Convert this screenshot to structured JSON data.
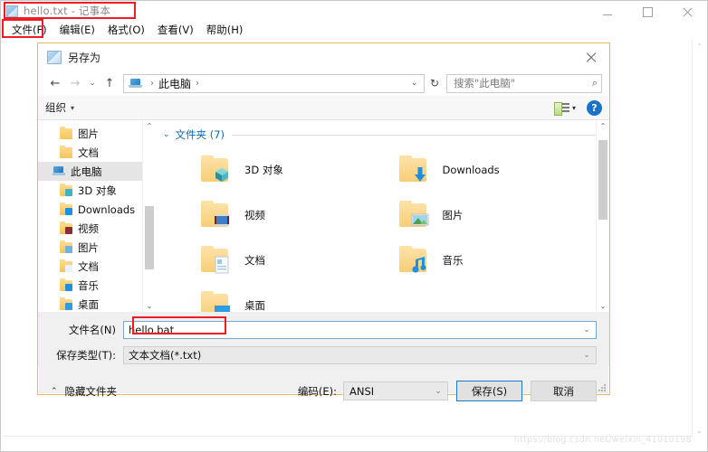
{
  "notepad": {
    "title": "hello.txt - 记事本",
    "icon": "notepad-icon",
    "window_controls": {
      "minimize": "–",
      "maximize": "□",
      "close": "×"
    },
    "menus": [
      {
        "label": "文件(F)",
        "name": "menu-file"
      },
      {
        "label": "编辑(E)",
        "name": "menu-edit"
      },
      {
        "label": "格式(O)",
        "name": "menu-format"
      },
      {
        "label": "查看(V)",
        "name": "menu-view"
      },
      {
        "label": "帮助(H)",
        "name": "menu-help"
      }
    ]
  },
  "dialog": {
    "title": "另存为",
    "close_label": "×",
    "nav": {
      "back": "←",
      "forward": "→",
      "recent": "⌄",
      "up": "↑",
      "breadcrumb_root_icon": "this-pc-icon",
      "breadcrumb": [
        "此电脑"
      ],
      "separator": "›",
      "address_dropdown": "⌄",
      "refresh": "↻"
    },
    "search": {
      "placeholder": "搜索\"此电脑\"",
      "icon": "search-icon"
    },
    "toolbar": {
      "organize": "组织",
      "organize_caret": "▾",
      "view_caret": "▾",
      "help": "?"
    },
    "tree": [
      {
        "label": "图片",
        "icon": "folder-pictures",
        "selected": false,
        "indent": true
      },
      {
        "label": "文档",
        "icon": "folder-documents",
        "selected": false,
        "indent": true
      },
      {
        "label": "此电脑",
        "icon": "this-pc-icon",
        "selected": true,
        "indent": false
      },
      {
        "label": "3D 对象",
        "icon": "folder-3dobjects",
        "selected": false,
        "indent": true
      },
      {
        "label": "Downloads",
        "icon": "folder-downloads",
        "selected": false,
        "indent": true
      },
      {
        "label": "视频",
        "icon": "folder-videos",
        "selected": false,
        "indent": true
      },
      {
        "label": "图片",
        "icon": "folder-pictures",
        "selected": false,
        "indent": true
      },
      {
        "label": "文档",
        "icon": "folder-documents",
        "selected": false,
        "indent": true
      },
      {
        "label": "音乐",
        "icon": "folder-music",
        "selected": false,
        "indent": true
      },
      {
        "label": "桌面",
        "icon": "folder-desktop",
        "selected": false,
        "indent": true
      }
    ],
    "group_header": "文件夹 (7)",
    "group_caret": "⌄",
    "folders": [
      {
        "label": "3D 对象",
        "icon": "folder-3dobjects"
      },
      {
        "label": "Downloads",
        "icon": "folder-downloads"
      },
      {
        "label": "视频",
        "icon": "folder-videos"
      },
      {
        "label": "图片",
        "icon": "folder-pictures"
      },
      {
        "label": "文档",
        "icon": "folder-documents"
      },
      {
        "label": "音乐",
        "icon": "folder-music"
      },
      {
        "label": "桌面",
        "icon": "folder-desktop"
      }
    ],
    "form": {
      "filename_label": "文件名(N)",
      "filename_value": "hello.bat",
      "filetype_label": "保存类型(T):",
      "filetype_value": "文本文档(*.txt)",
      "dropdown_caret": "⌄"
    },
    "footer": {
      "hide_folders": "隐藏文件夹",
      "hide_caret": "⌃",
      "encoding_label": "编码(E):",
      "encoding_value": "ANSI",
      "save_button": "保存(S)",
      "cancel_button": "取消"
    },
    "scrollbar": {
      "up": "⌃",
      "down": "⌄"
    }
  },
  "annotations": {
    "highlight_color": "#ee1c24",
    "boxes": [
      "title-highlight",
      "file-menu-highlight",
      "filename-highlight"
    ]
  },
  "watermark": "https://blog.csdn.net/weixin_41010198"
}
